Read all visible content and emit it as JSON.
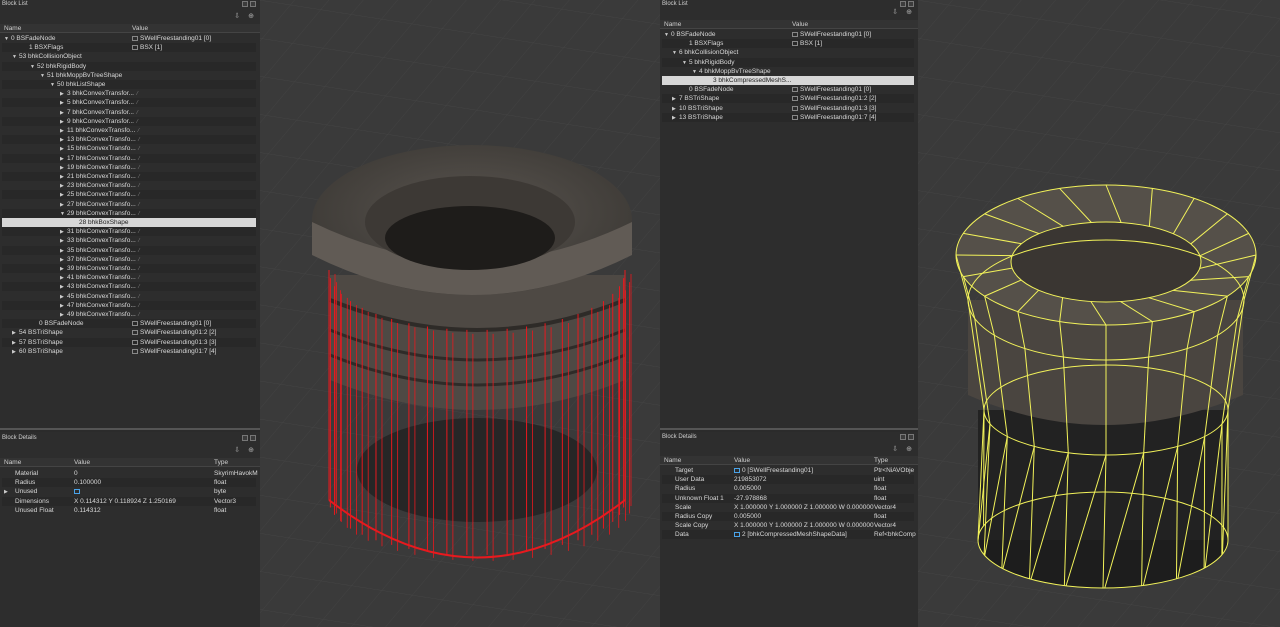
{
  "left": {
    "blocklist": {
      "title": "Block List",
      "cols": [
        "Name",
        "Value"
      ],
      "rows": [
        {
          "a": "▼",
          "name": "0 BSFadeNode",
          "value": "SWellFreestanding01 [0]",
          "vi": true
        },
        {
          "a": "",
          "name": "1 BSXFlags",
          "value": "BSX [1]",
          "vi": true
        },
        {
          "a": "▼",
          "name": "53 bhkCollisionObject",
          "value": ""
        },
        {
          "a": "▼",
          "name": "52 bhkRigidBody",
          "value": ""
        },
        {
          "a": "▼",
          "name": "51 bhkMoppBvTreeShape",
          "value": ""
        },
        {
          "a": "▼",
          "name": "50 bhkListShape",
          "value": ""
        },
        {
          "a": "▶",
          "name": "3 bhkConvexTransfor...",
          "value": "",
          "p": true
        },
        {
          "a": "▶",
          "name": "5 bhkConvexTransfor...",
          "value": "",
          "p": true
        },
        {
          "a": "▶",
          "name": "7 bhkConvexTransfor...",
          "value": "",
          "p": true
        },
        {
          "a": "▶",
          "name": "9 bhkConvexTransfor...",
          "value": "",
          "p": true
        },
        {
          "a": "▶",
          "name": "11 bhkConvexTransfo...",
          "value": "",
          "p": true
        },
        {
          "a": "▶",
          "name": "13 bhkConvexTransfo...",
          "value": "",
          "p": true
        },
        {
          "a": "▶",
          "name": "15 bhkConvexTransfo...",
          "value": "",
          "p": true
        },
        {
          "a": "▶",
          "name": "17 bhkConvexTransfo...",
          "value": "",
          "p": true
        },
        {
          "a": "▶",
          "name": "19 bhkConvexTransfo...",
          "value": "",
          "p": true
        },
        {
          "a": "▶",
          "name": "21 bhkConvexTransfo...",
          "value": "",
          "p": true
        },
        {
          "a": "▶",
          "name": "23 bhkConvexTransfo...",
          "value": "",
          "p": true
        },
        {
          "a": "▶",
          "name": "25 bhkConvexTransfo...",
          "value": "",
          "p": true
        },
        {
          "a": "▶",
          "name": "27 bhkConvexTransfo...",
          "value": "",
          "p": true
        },
        {
          "a": "▼",
          "name": "29 bhkConvexTransfo...",
          "value": "",
          "p": true
        },
        {
          "a": "",
          "name": "28 bhkBoxShape",
          "value": "",
          "sel": true
        },
        {
          "a": "▶",
          "name": "31 bhkConvexTransfo...",
          "value": "",
          "p": true
        },
        {
          "a": "▶",
          "name": "33 bhkConvexTransfo...",
          "value": "",
          "p": true
        },
        {
          "a": "▶",
          "name": "35 bhkConvexTransfo...",
          "value": "",
          "p": true
        },
        {
          "a": "▶",
          "name": "37 bhkConvexTransfo...",
          "value": "",
          "p": true
        },
        {
          "a": "▶",
          "name": "39 bhkConvexTransfo...",
          "value": "",
          "p": true
        },
        {
          "a": "▶",
          "name": "41 bhkConvexTransfo...",
          "value": "",
          "p": true
        },
        {
          "a": "▶",
          "name": "43 bhkConvexTransfo...",
          "value": "",
          "p": true
        },
        {
          "a": "▶",
          "name": "45 bhkConvexTransfo...",
          "value": "",
          "p": true
        },
        {
          "a": "▶",
          "name": "47 bhkConvexTransfo...",
          "value": "",
          "p": true
        },
        {
          "a": "▶",
          "name": "49 bhkConvexTransfo...",
          "value": "",
          "p": true
        },
        {
          "a": "",
          "name": "0 BSFadeNode",
          "value": "SWellFreestanding01 [0]",
          "vi": true
        },
        {
          "a": "▶",
          "name": "54 BSTriShape",
          "value": "SWellFreestanding01:2 [2]",
          "vi": true
        },
        {
          "a": "▶",
          "name": "57 BSTriShape",
          "value": "SWellFreestanding01:3 [3]",
          "vi": true
        },
        {
          "a": "▶",
          "name": "60 BSTriShape",
          "value": "SWellFreestanding01:7 [4]",
          "vi": true
        }
      ]
    },
    "details": {
      "title": "Block Details",
      "cols": [
        "Name",
        "Value",
        "Type"
      ],
      "rows": [
        {
          "a": "",
          "name": "Material",
          "value": "0",
          "type": "SkyrimHavokM"
        },
        {
          "a": "",
          "name": "Radius",
          "value": "0.100000",
          "type": "float"
        },
        {
          "a": "▶",
          "name": "Unused",
          "value": "",
          "type": "byte",
          "ic": true
        },
        {
          "a": "",
          "name": "Dimensions",
          "value": "X 0.114312 Y 0.118924 Z 1.250169",
          "type": "Vector3"
        },
        {
          "a": "",
          "name": "Unused Float",
          "value": "0.114312",
          "type": "float"
        }
      ]
    }
  },
  "right": {
    "blocklist": {
      "title": "Block List",
      "cols": [
        "Name",
        "Value"
      ],
      "rows": [
        {
          "a": "▼",
          "name": "0 BSFadeNode",
          "value": "SWellFreestanding01 [0]",
          "vi": true
        },
        {
          "a": "",
          "name": "1 BSXFlags",
          "value": "BSX [1]",
          "vi": true
        },
        {
          "a": "▼",
          "name": "6 bhkCollisionObject",
          "value": ""
        },
        {
          "a": "▼",
          "name": "5 bhkRigidBody",
          "value": ""
        },
        {
          "a": "▼",
          "name": "4 bhkMoppBvTreeShape",
          "value": ""
        },
        {
          "a": "",
          "name": "3 bhkCompressedMeshS...",
          "value": "",
          "sel": true
        },
        {
          "a": "",
          "name": "0 BSFadeNode",
          "value": "SWellFreestanding01 [0]",
          "vi": true
        },
        {
          "a": "▶",
          "name": "7 BSTriShape",
          "value": "SWellFreestanding01:2 [2]",
          "vi": true
        },
        {
          "a": "▶",
          "name": "10 BSTriShape",
          "value": "SWellFreestanding01:3 [3]",
          "vi": true
        },
        {
          "a": "▶",
          "name": "13 BSTriShape",
          "value": "SWellFreestanding01:7 [4]",
          "vi": true
        }
      ]
    },
    "details": {
      "title": "Block Details",
      "cols": [
        "Name",
        "Value",
        "Type"
      ],
      "rows": [
        {
          "a": "",
          "name": "Target",
          "value": "0 [SWellFreestanding01]",
          "type": "Ptr<NiAVObje",
          "ic": true
        },
        {
          "a": "",
          "name": "User Data",
          "value": "219853072",
          "type": "uint"
        },
        {
          "a": "",
          "name": "Radius",
          "value": "0.005000",
          "type": "float"
        },
        {
          "a": "",
          "name": "Unknown Float 1",
          "value": "-27.978868",
          "type": "float"
        },
        {
          "a": "",
          "name": "Scale",
          "value": "X 1.000000 Y 1.000000 Z 1.000000 W 0.000000",
          "type": "Vector4"
        },
        {
          "a": "",
          "name": "Radius Copy",
          "value": "0.005000",
          "type": "float"
        },
        {
          "a": "",
          "name": "Scale Copy",
          "value": "X 1.000000 Y 1.000000 Z 1.000000 W 0.000000",
          "type": "Vector4"
        },
        {
          "a": "",
          "name": "Data",
          "value": "2 [bhkCompressedMeshShapeData]",
          "type": "Ref<bhkComp",
          "ic": true
        }
      ]
    }
  },
  "colors": {
    "collision_left": "#e8191e",
    "collision_right": "#f2f25a"
  }
}
